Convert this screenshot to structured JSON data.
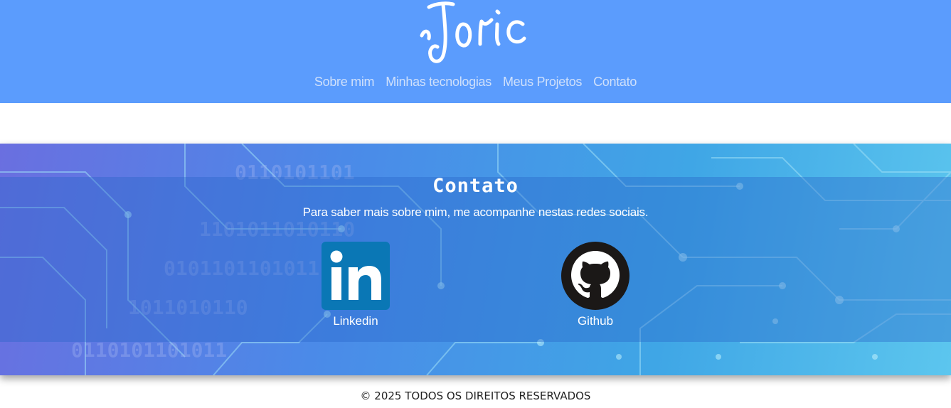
{
  "header": {
    "logo_text": "Joric",
    "nav": [
      {
        "label": "Sobre mim"
      },
      {
        "label": "Minhas tecnologias"
      },
      {
        "label": "Meus Projetos"
      },
      {
        "label": "Contato"
      }
    ]
  },
  "contact": {
    "title": "Contato",
    "description": "Para saber mais sobre mim, me acompanhe nestas redes sociais.",
    "links": [
      {
        "label": "Linkedin",
        "icon": "linkedin-icon"
      },
      {
        "label": "Github",
        "icon": "github-icon"
      }
    ]
  },
  "footer": {
    "copyright": "© 2025 TODOS OS DIREITOS RESERVADOS"
  },
  "colors": {
    "header_bg": "#5b9cfd",
    "nav_text": "#cfe0fb",
    "linkedin": "#0a77b5",
    "github": "#1b1817"
  }
}
